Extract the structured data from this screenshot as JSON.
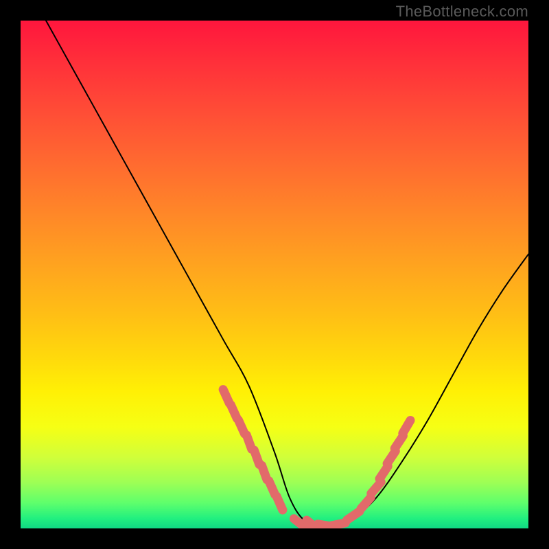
{
  "watermark": "TheBottleneck.com",
  "chart_data": {
    "type": "line",
    "title": "",
    "xlabel": "",
    "ylabel": "",
    "xlim": [
      0,
      100
    ],
    "ylim": [
      0,
      100
    ],
    "grid": false,
    "legend": false,
    "series": [
      {
        "name": "bottleneck-curve",
        "x": [
          5,
          10,
          15,
          20,
          25,
          30,
          35,
          40,
          45,
          50,
          53,
          56,
          60,
          62,
          65,
          70,
          75,
          80,
          85,
          90,
          95,
          100
        ],
        "y": [
          100,
          91,
          82,
          73,
          64,
          55,
          46,
          37,
          28,
          15,
          6,
          1.5,
          0.5,
          0.5,
          1.5,
          6,
          13,
          21,
          30,
          39,
          47,
          54
        ]
      }
    ],
    "markers": [
      {
        "name": "left-cluster",
        "x": [
          40.5,
          42.0,
          43.5,
          45.0,
          46.5,
          48.0,
          49.5,
          51.0
        ],
        "y": [
          26.0,
          23.0,
          20.0,
          17.0,
          14.0,
          11.0,
          8.0,
          5.0
        ]
      },
      {
        "name": "bottom-cluster",
        "x": [
          55.0,
          57.5,
          60.0,
          62.5
        ],
        "y": [
          1.0,
          0.7,
          0.6,
          0.8
        ]
      },
      {
        "name": "right-cluster",
        "x": [
          65.5,
          68.0,
          70.0,
          71.5,
          73.0,
          74.5,
          76.0
        ],
        "y": [
          2.5,
          5.0,
          8.0,
          11.0,
          14.0,
          17.0,
          20.0
        ]
      }
    ],
    "colors": {
      "curve": "#000000",
      "marker": "#e26a6a"
    }
  }
}
